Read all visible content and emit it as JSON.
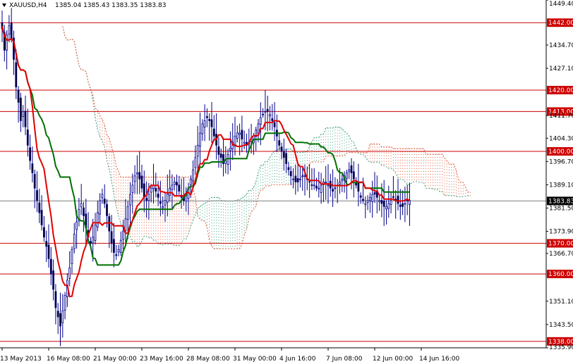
{
  "header": {
    "symbol": "XAUUSD,H4",
    "ohlc": "1385.04 1385.43 1383.35 1383.83",
    "menu_icon": "triangle-down-icon"
  },
  "chart_data": {
    "type": "candlestick",
    "title": "",
    "xlabel": "",
    "ylabel": "",
    "ylim": [
      1335.9,
      1449.4
    ],
    "grid": false,
    "y_ticks": [
      "1449.40",
      "1434.70",
      "1427.10",
      "1411.70",
      "1404.30",
      "1396.70",
      "1389.10",
      "1381.50",
      "1373.90",
      "1366.70",
      "1351.10",
      "1343.50",
      "1335.90"
    ],
    "x_ticks": [
      "13 May 2013",
      "16 May 08:00",
      "21 May 00:00",
      "23 May 16:00",
      "28 May 08:00",
      "31 May 00:00",
      "4 Jun 16:00",
      "7 Jun 08:00",
      "12 Jun 00:00",
      "14 Jun 16:00"
    ],
    "x_tick_bar_index": [
      0,
      20,
      40,
      60,
      80,
      100,
      120,
      140,
      160,
      180
    ],
    "current_price": "1383.83",
    "levels": [
      {
        "value": 1442.0,
        "label": "1442.00"
      },
      {
        "value": 1420.0,
        "label": "1420.00"
      },
      {
        "value": 1413.0,
        "label": "1413.00"
      },
      {
        "value": 1400.0,
        "label": "1400.00"
      },
      {
        "value": 1370.0,
        "label": "1370.00"
      },
      {
        "value": 1360.0,
        "label": "1360.00"
      },
      {
        "value": 1338.0,
        "label": "1338.00"
      }
    ],
    "colors": {
      "level_line": "#cc0000",
      "level_label_bg": "#cc0000",
      "candle": "#00008b",
      "tenkan": "#e00000",
      "kijun": "#007000",
      "kumo_bear": "#e06040",
      "kumo_bull": "#40a080",
      "price_line": "#808080"
    },
    "series": [
      {
        "key": "close",
        "values": [
          1440,
          1433,
          1438,
          1441,
          1437,
          1430,
          1421,
          1416,
          1410,
          1413,
          1408,
          1402,
          1397,
          1393,
          1388,
          1384,
          1380,
          1376,
          1372,
          1369,
          1365,
          1360,
          1355,
          1349,
          1346,
          1343,
          1348,
          1353,
          1358,
          1362,
          1368,
          1373,
          1377,
          1381,
          1383,
          1379,
          1375,
          1372,
          1370,
          1372,
          1376,
          1380,
          1384,
          1386,
          1383,
          1379,
          1374,
          1370,
          1367,
          1366,
          1368,
          1371,
          1374,
          1378,
          1382,
          1386,
          1389,
          1392,
          1393,
          1391,
          1388,
          1385,
          1384,
          1386,
          1388,
          1389,
          1387,
          1385,
          1383,
          1382,
          1384,
          1386,
          1388,
          1389,
          1390,
          1389,
          1387,
          1385,
          1384,
          1386,
          1388,
          1391,
          1394,
          1398,
          1402,
          1406,
          1409,
          1410,
          1411,
          1410,
          1408,
          1405,
          1402,
          1399,
          1398,
          1396,
          1397,
          1399,
          1401,
          1403,
          1405,
          1406,
          1406,
          1404,
          1403,
          1402,
          1403,
          1404,
          1405,
          1407,
          1409,
          1411,
          1412,
          1413,
          1413,
          1412,
          1410,
          1408,
          1405,
          1402,
          1400,
          1398,
          1396,
          1394,
          1392,
          1391,
          1390,
          1390,
          1391,
          1392,
          1392,
          1391,
          1390,
          1389,
          1389,
          1388,
          1388,
          1389,
          1390,
          1390,
          1389,
          1388,
          1387,
          1388,
          1389,
          1390,
          1391,
          1392,
          1393,
          1394,
          1393,
          1391,
          1389,
          1387,
          1385,
          1384,
          1383,
          1384,
          1385,
          1386,
          1386,
          1385,
          1384,
          1383,
          1382,
          1382,
          1383,
          1384,
          1385,
          1384,
          1383,
          1382,
          1382,
          1383,
          1384,
          1384
        ]
      },
      {
        "key": "tenkan",
        "values": []
      },
      {
        "key": "kijun",
        "values": []
      }
    ]
  }
}
